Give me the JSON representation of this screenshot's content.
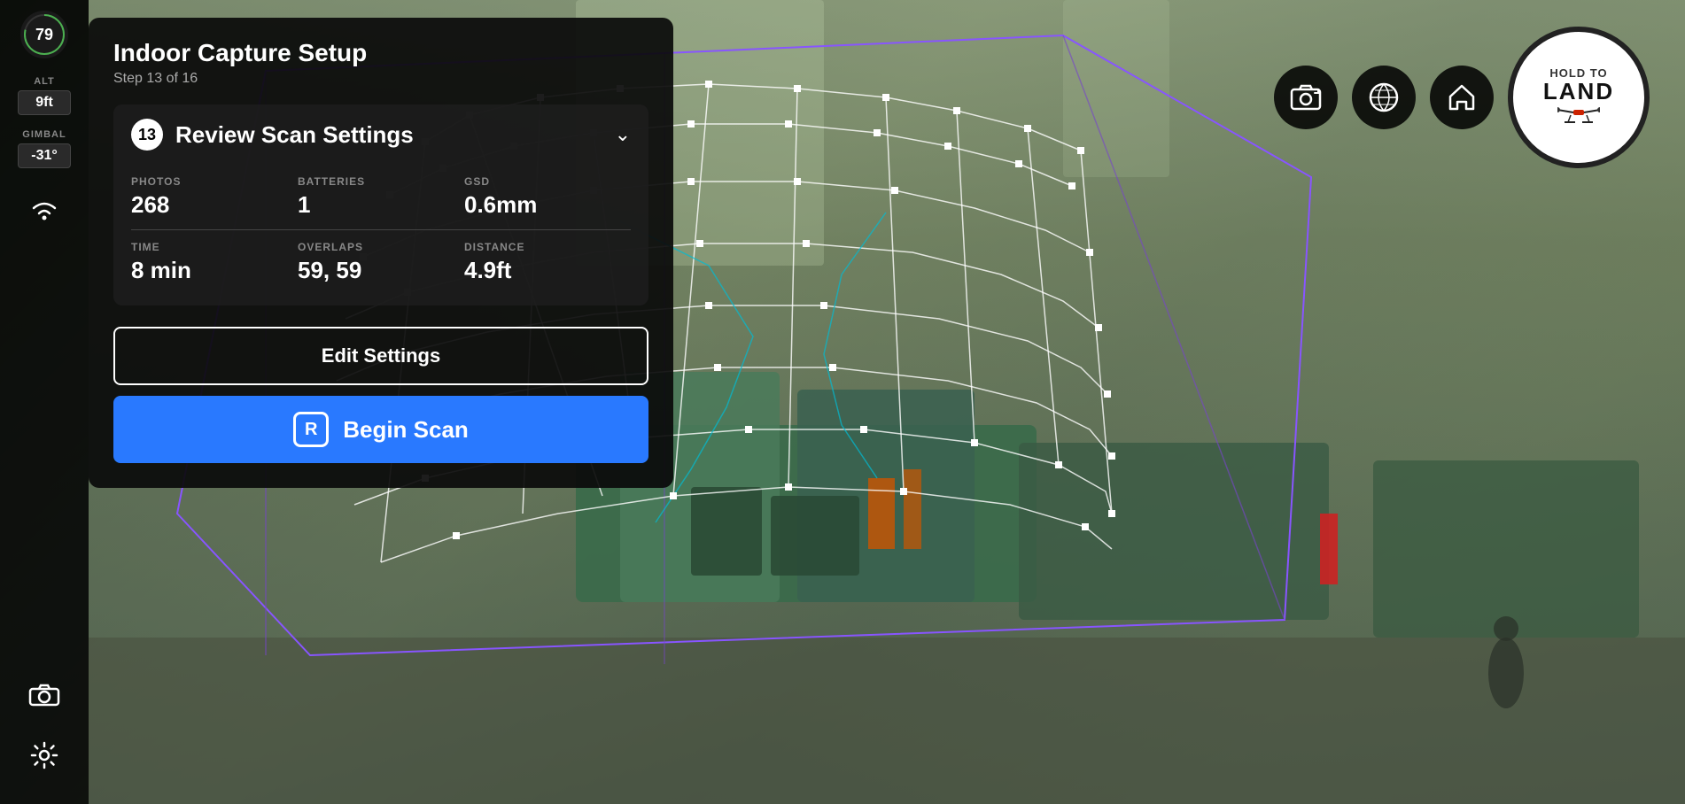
{
  "sidebar": {
    "battery_percent": "79",
    "alt_label": "ALT",
    "alt_value": "9ft",
    "gimbal_label": "GIMBAL",
    "gimbal_value": "-31°"
  },
  "panel": {
    "title": "Indoor Capture Setup",
    "subtitle": "Step 13 of 16",
    "step_number": "13",
    "step_title": "Review Scan Settings",
    "stats": {
      "photos_label": "PHOTOS",
      "photos_value": "268",
      "batteries_label": "BATTERIES",
      "batteries_value": "1",
      "gsd_label": "GSD",
      "gsd_value": "0.6mm",
      "time_label": "TIME",
      "time_value": "8 min",
      "overlaps_label": "OVERLAPS",
      "overlaps_value": "59, 59",
      "distance_label": "DISTANCE",
      "distance_value": "4.9ft"
    },
    "edit_settings_label": "Edit Settings",
    "begin_scan_label": "Begin Scan",
    "begin_scan_key": "R"
  },
  "controls": {
    "hold_to_land_top": "HOLD TO",
    "hold_to_land_main": "LAND"
  }
}
